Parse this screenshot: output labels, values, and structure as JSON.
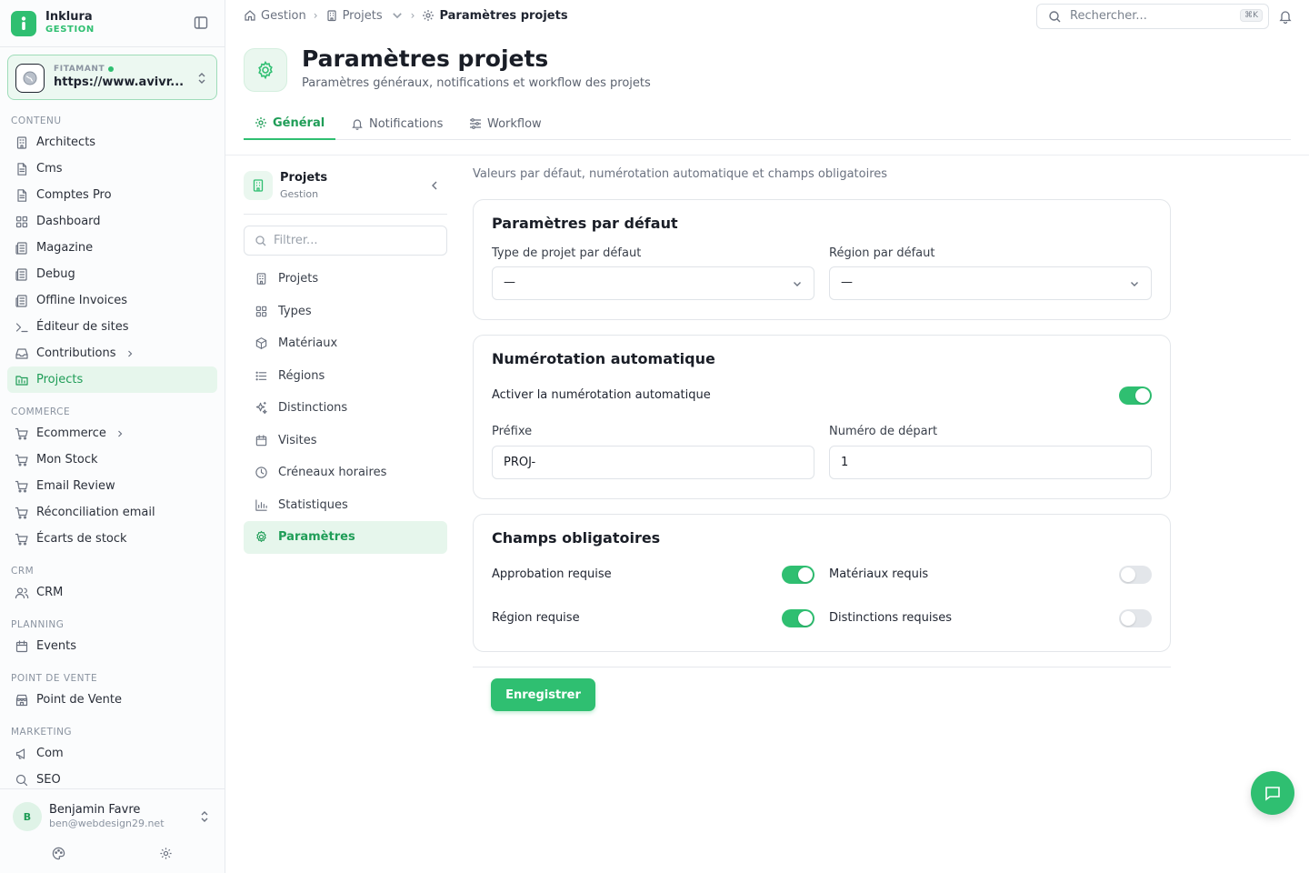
{
  "brand": {
    "name": "Inklura",
    "sub": "GESTION"
  },
  "site": {
    "label": "FITAMANT",
    "url": "https://www.avivr..."
  },
  "nav": {
    "sections": [
      {
        "title": "CONTENU",
        "items": [
          {
            "label": "Architects",
            "icon": "building-icon"
          },
          {
            "label": "Cms",
            "icon": "file-icon"
          },
          {
            "label": "Comptes Pro",
            "icon": "file-icon"
          },
          {
            "label": "Dashboard",
            "icon": "grid-icon"
          },
          {
            "label": "Magazine",
            "icon": "newspaper-icon"
          },
          {
            "label": "Debug",
            "icon": "newspaper-icon"
          },
          {
            "label": "Offline Invoices",
            "icon": "newspaper-icon"
          },
          {
            "label": "Éditeur de sites",
            "icon": "terminal-icon"
          },
          {
            "label": "Contributions",
            "icon": "inbox-icon",
            "has_children": true
          },
          {
            "label": "Projects",
            "icon": "folder-icon",
            "active": true
          }
        ]
      },
      {
        "title": "COMMERCE",
        "items": [
          {
            "label": "Ecommerce",
            "icon": "cart-icon",
            "has_children": true
          },
          {
            "label": "Mon Stock",
            "icon": "cart-icon"
          },
          {
            "label": "Email Review",
            "icon": "cart-icon"
          },
          {
            "label": "Réconciliation email",
            "icon": "cart-icon"
          },
          {
            "label": "Écarts de stock",
            "icon": "cart-icon"
          }
        ]
      },
      {
        "title": "CRM",
        "items": [
          {
            "label": "CRM",
            "icon": "users-icon"
          }
        ]
      },
      {
        "title": "PLANNING",
        "items": [
          {
            "label": "Events",
            "icon": "calendar-icon"
          }
        ]
      },
      {
        "title": "POINT DE VENTE",
        "items": [
          {
            "label": "Point de Vente",
            "icon": "store-icon"
          }
        ]
      },
      {
        "title": "MARKETING",
        "items": [
          {
            "label": "Com",
            "icon": "megaphone-icon"
          },
          {
            "label": "SEO",
            "icon": "search-icon"
          }
        ]
      }
    ]
  },
  "user": {
    "initial": "B",
    "name": "Benjamin Favre",
    "email": "ben@webdesign29.net"
  },
  "breadcrumb": {
    "home": "Gestion",
    "section": "Projets",
    "current": "Paramètres projets"
  },
  "search": {
    "placeholder": "Rechercher...",
    "shortcut": "⌘K"
  },
  "header": {
    "title": "Paramètres projets",
    "subtitle": "Paramètres généraux, notifications et workflow des projets"
  },
  "tabs": [
    {
      "label": "Général",
      "active": true
    },
    {
      "label": "Notifications"
    },
    {
      "label": "Workflow"
    }
  ],
  "subpanel": {
    "title": "Projets",
    "subtitle": "Gestion",
    "filter_placeholder": "Filtrer...",
    "items": [
      {
        "label": "Projets",
        "icon": "building-icon"
      },
      {
        "label": "Types",
        "icon": "grid-icon"
      },
      {
        "label": "Matériaux",
        "icon": "box-icon"
      },
      {
        "label": "Régions",
        "icon": "list-icon"
      },
      {
        "label": "Distinctions",
        "icon": "sparkle-icon"
      },
      {
        "label": "Visites",
        "icon": "calendar-icon"
      },
      {
        "label": "Créneaux horaires",
        "icon": "clock-icon"
      },
      {
        "label": "Statistiques",
        "icon": "bar-chart-icon"
      },
      {
        "label": "Paramètres",
        "icon": "gear-icon",
        "active": true
      }
    ]
  },
  "content": {
    "description": "Valeurs par défaut, numérotation automatique et champs obligatoires",
    "defaults": {
      "title": "Paramètres par défaut",
      "project_type_label": "Type de projet par défaut",
      "project_type_value": "—",
      "region_label": "Région par défaut",
      "region_value": "—"
    },
    "numbering": {
      "title": "Numérotation automatique",
      "toggle_label": "Activer la numérotation automatique",
      "enabled": true,
      "prefix_label": "Préfixe",
      "prefix_value": "PROJ-",
      "start_label": "Numéro de départ",
      "start_value": "1"
    },
    "required": {
      "title": "Champs obligatoires",
      "fields": [
        {
          "label": "Approbation requise",
          "on": true
        },
        {
          "label": "Matériaux requis",
          "on": false
        },
        {
          "label": "Région requise",
          "on": true
        },
        {
          "label": "Distinctions requises",
          "on": false
        }
      ]
    },
    "save_label": "Enregistrer"
  },
  "colors": {
    "accent": "#2fbf71",
    "accent_soft": "#e6f6ec",
    "text": "#1f2430"
  }
}
